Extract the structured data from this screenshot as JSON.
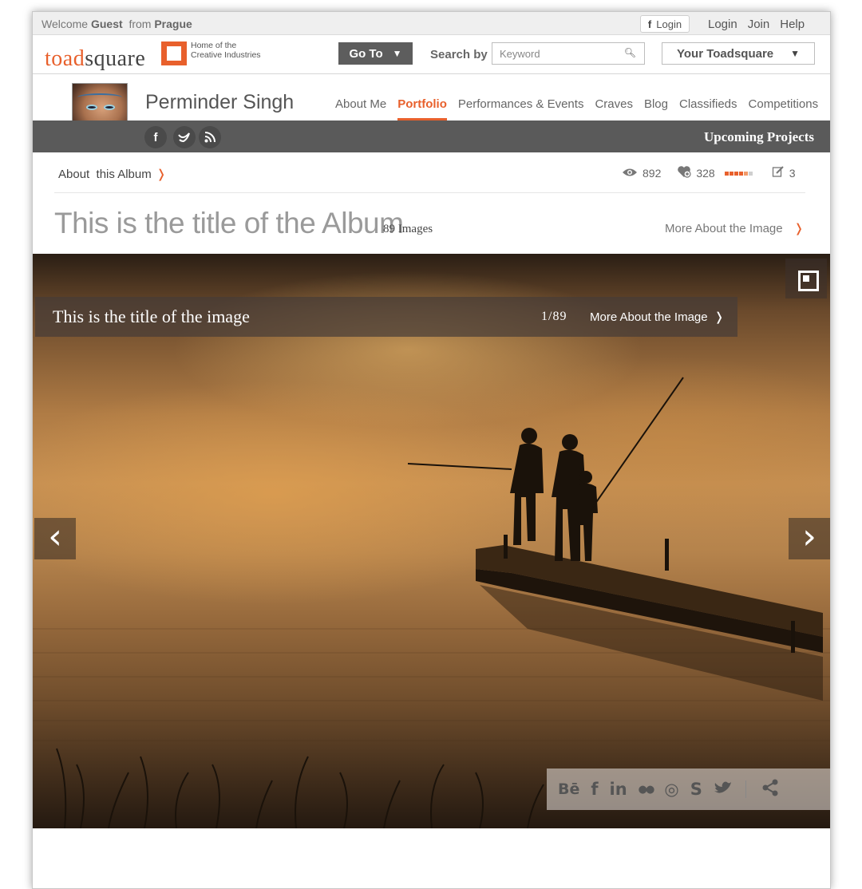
{
  "topbar": {
    "welcome_prefix": "Welcome",
    "user": "Guest",
    "from_label": "from",
    "city": "Prague",
    "fb_login": "Login",
    "login": "Login",
    "join": "Join",
    "help": "Help"
  },
  "header": {
    "logo_part1": "toad",
    "logo_part2": "square",
    "tagline_line1": "Home of the",
    "tagline_line2": "Creative Industries",
    "goto_label": "Go To",
    "goto_arrow": "▼",
    "search_by_label": "Search by",
    "search_placeholder": "Keyword",
    "your_toadsquare": "Your Toadsquare",
    "your_toadsquare_arrow": "▼"
  },
  "profile": {
    "name": "Perminder Singh",
    "nav": [
      "About Me",
      "Portfolio",
      "Performances & Events",
      "Craves",
      "Blog",
      "Classifieds",
      "Competitions"
    ],
    "active_nav": "Portfolio",
    "upcoming": "Upcoming Projects"
  },
  "album": {
    "about_label": "About  this Album",
    "about_chevron": "❭",
    "views": "892",
    "likes": "328",
    "reviews": "3",
    "rating_colors": [
      "#e8602c",
      "#e8602c",
      "#e8602c",
      "#e8602c",
      "#f29a6a",
      "#cfcfcf"
    ],
    "title": "This is the title of the Album",
    "image_count": "89 Images",
    "more_about": "More About the Image",
    "more_chevron": "❭"
  },
  "viewer": {
    "image_title": "This is the title of the image",
    "counter": "1/89",
    "more_about": "More About the Image",
    "more_chevron": "❭",
    "prev_arrow": "‹",
    "next_arrow": "›"
  },
  "share": {
    "icons": [
      "Bē",
      "f",
      "in",
      "●●",
      "◎",
      "S",
      "🐦"
    ]
  }
}
